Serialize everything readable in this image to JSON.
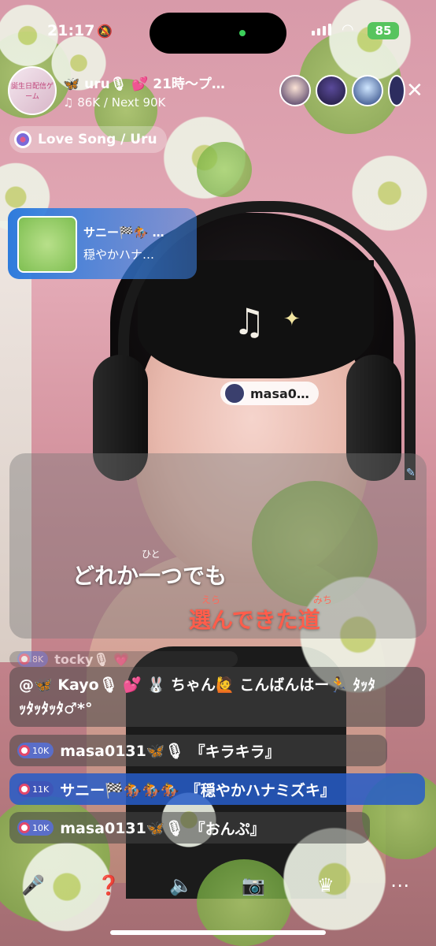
{
  "status": {
    "time": "21:17",
    "battery": "85"
  },
  "host": {
    "avatar_text": "誕生日配信ゲーム",
    "title": "🦋 uru🎙 💕 21時〜プ…",
    "points": "86K / Next 90K"
  },
  "song": {
    "label": "Love Song / Uru"
  },
  "gift": {
    "name": "サニー🏁🏇 …",
    "message": "穏やかハナ…"
  },
  "name_tag": {
    "label": "masa0…"
  },
  "lyrics": {
    "line1": "どれか一つでも",
    "line1_ruby": "ひと",
    "line2": "選んできた道",
    "line2_ruby_a": "えら",
    "line2_ruby_b": "みち"
  },
  "comments": [
    {
      "level": "8K",
      "user": "tocky🎙 💗",
      "text": ""
    },
    {
      "level": "10K",
      "user": "masa0131🦋🎙",
      "text": "『キラキラ』"
    },
    {
      "level": "11K",
      "user": "サニー🏁🏇🏇🏇",
      "text": "『穏やかハナミズキ』"
    },
    {
      "level": "10K",
      "user": "masa0131🦋🎙",
      "text": "『おんぷ』"
    }
  ],
  "big_comment": {
    "line1": "@🦋 Kayo🎙 💕 🐰 ちゃん🙋 こんばんはー🏃 ﾀｯﾀ",
    "line2": "ｯﾀｯﾀｯﾀ♂*°"
  },
  "toolbar": {
    "mic": "mic-icon",
    "quiz": "question-icon",
    "speaker": "speaker-icon",
    "camera": "camera-flip-icon",
    "crown": "crown-icon",
    "more": "more-icon"
  },
  "colors": {
    "accent": "#2f7bdc",
    "lyric_highlight": "#ff5d4b",
    "level_badge": "#5a6ec9"
  }
}
